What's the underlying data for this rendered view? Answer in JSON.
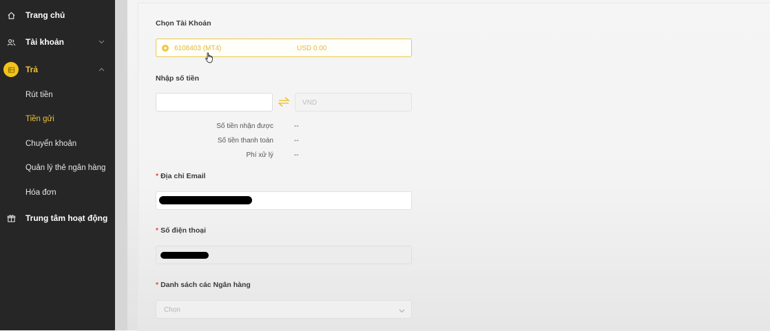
{
  "sidebar": {
    "home": "Trang chủ",
    "account": "Tài khoản",
    "pay": "Trả",
    "sub_items": [
      "Rút tiền",
      "Tiền gửi",
      "Chuyển khoản",
      "Quản lý thẻ ngân hàng",
      "Hóa đơn"
    ],
    "activity_center": "Trung tâm hoạt động"
  },
  "form": {
    "choose_account_label": "Chọn Tài Khoản",
    "account_value": "6108403 (MT4)",
    "account_balance": "USD 0.00",
    "amount_label": "Nhập số tiền",
    "amount_value": "",
    "currency": "VND",
    "received_label": "Số tiền nhận được",
    "received_value": "--",
    "payment_label": "Số tiền thanh toán",
    "payment_value": "--",
    "fee_label": "Phí xử lý",
    "fee_value": "--",
    "email_label": "Địa chỉ Email",
    "phone_label": "Số điện thoại",
    "bank_list_label": "Danh sách các Ngân hàng",
    "bank_placeholder": "Chọn",
    "required_mark": "*"
  },
  "colors": {
    "accent": "#f3c21b",
    "sidebar_bg": "#262626",
    "active_text": "#f0c23a"
  }
}
